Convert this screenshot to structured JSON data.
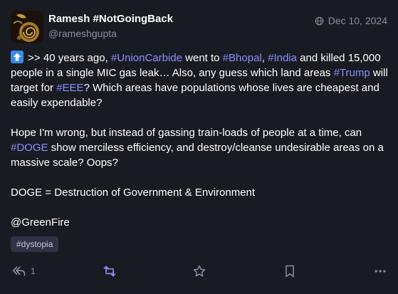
{
  "post": {
    "display_name": "Ramesh #NotGoingBack",
    "handle": "@rameshgupta",
    "date": "Dec 10, 2024",
    "paragraph1": {
      "t1": " >> 40 years ago, ",
      "tag1": "#UnionCarbide",
      "t2": " went to ",
      "tag2": "#Bhopal",
      "t3": ", ",
      "tag3": "#India",
      "t4": " and killed 15,000 people in a single MIC gas leak… Also, any guess which land areas ",
      "tag4": "#Trump",
      "t5": " will target for ",
      "tag5": "#EEE",
      "t6": "? Which areas have populations whose lives are cheapest and easily expendable?"
    },
    "paragraph2": {
      "t1": "Hope I'm wrong, but instead of gassing train-loads of people at a time, can ",
      "tag1": "#DOGE",
      "t2": " show merciless efficiency, and destroy/cleanse undesirable areas on a massive scale? Oops?"
    },
    "paragraph3": "DOGE = Destruction of Government & Environment",
    "paragraph4": "@GreenFire",
    "hashtag_chip": "#dystopia",
    "reply_count": "1"
  },
  "icons": {
    "avatar": "avatar-image",
    "date": "globe-icon",
    "emoji": "up-arrow-emoji",
    "reply": "reply-all-icon",
    "boost": "boost-icon",
    "favourite": "star-icon",
    "bookmark": "bookmark-icon",
    "more": "more-icon"
  },
  "colors": {
    "background": "#191b22",
    "text": "#ffffff",
    "muted": "#8b8ea3",
    "hashtag": "#8c8dff",
    "boost_active": "#8c8dff",
    "chip_bg": "#2f3244"
  }
}
